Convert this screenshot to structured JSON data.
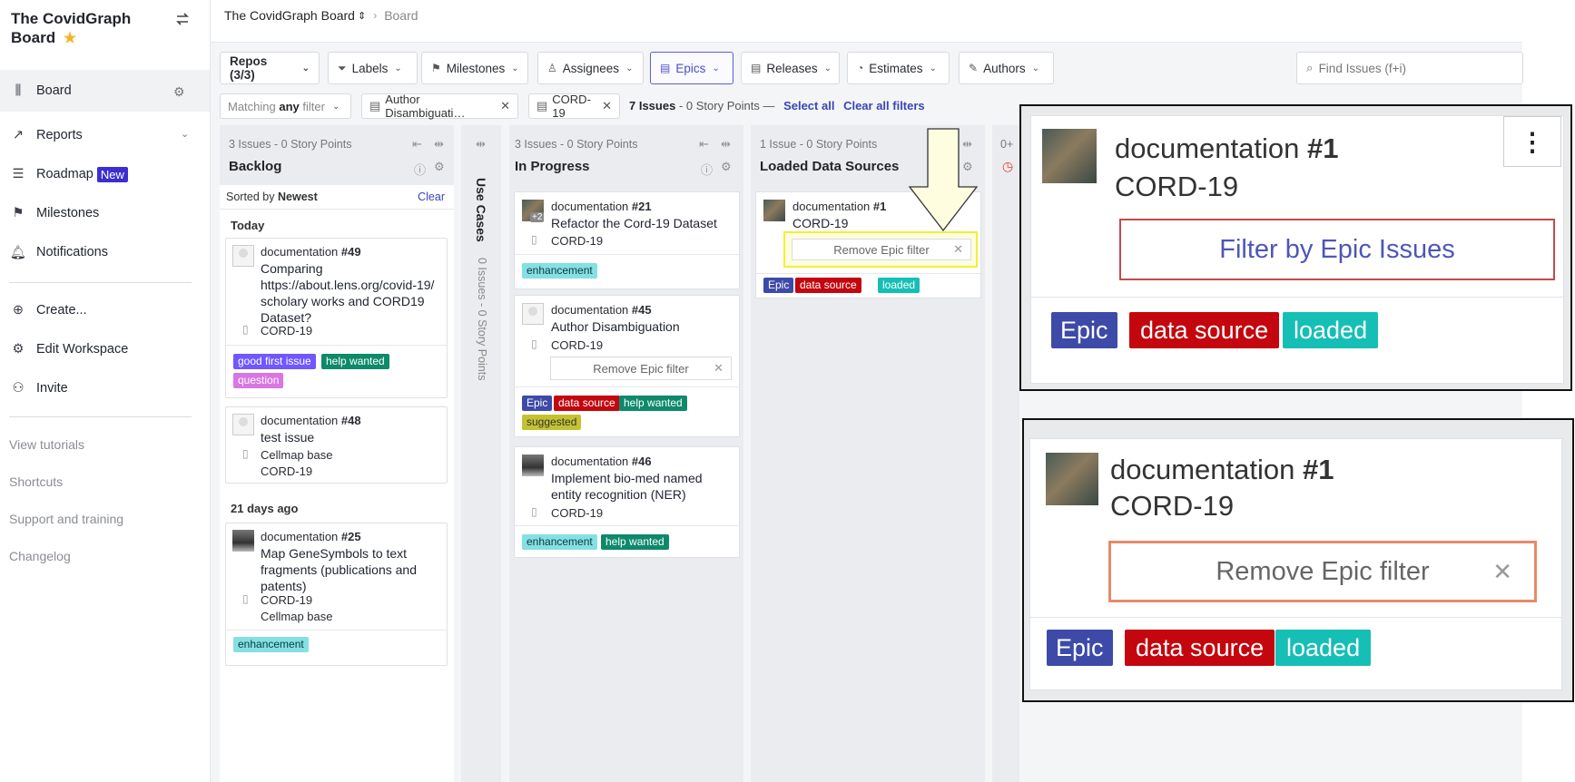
{
  "sidebar": {
    "workspace_title": "The CovidGraph Board",
    "nav": [
      {
        "label": "Board"
      },
      {
        "label": "Reports"
      },
      {
        "label": "Roadmap",
        "badge": "New"
      },
      {
        "label": "Milestones"
      },
      {
        "label": "Notifications"
      },
      {
        "label": "Create..."
      },
      {
        "label": "Edit Workspace"
      },
      {
        "label": "Invite"
      }
    ],
    "links": [
      "View tutorials",
      "Shortcuts",
      "Support and training",
      "Changelog"
    ]
  },
  "breadcrumb": {
    "workspace": "The CovidGraph Board",
    "current": "Board"
  },
  "filters": {
    "buttons": [
      "Repos (3/3)",
      "Labels",
      "Milestones",
      "Assignees",
      "Epics",
      "Releases",
      "Estimates",
      "Authors"
    ],
    "search_placeholder": "Find Issues (f+i)",
    "matching_prefix": "Matching",
    "matching_value": "any",
    "matching_suffix": "filter",
    "chip1": "Author Disambiguati…",
    "chip2": "CORD-19",
    "summary_count": "7 Issues",
    "summary_rest": "- 0 Story Points —",
    "select_all": "Select all",
    "clear_all": "Clear all filters"
  },
  "columns": {
    "backlog": {
      "meta": "3 Issues - 0 Story Points",
      "title": "Backlog",
      "sorted_prefix": "Sorted by",
      "sorted_value": "Newest",
      "clear": "Clear",
      "group_today": "Today",
      "group_older": "21 days ago",
      "cards": [
        {
          "repo": "documentation",
          "num": "#49",
          "title": "Comparing https://about.lens.org/covid-19/ scholary works and CORD19 Dataset?",
          "epic": "CORD-19",
          "labels": [
            "good first issue",
            "help wanted",
            "question"
          ]
        },
        {
          "repo": "documentation",
          "num": "#48",
          "title": "test issue",
          "epic": "Cellmap base",
          "epic2": "CORD-19"
        },
        {
          "repo": "documentation",
          "num": "#25",
          "title": "Map GeneSymbols to text fragments (publications and patents)",
          "epic": "CORD-19",
          "epic2": "Cellmap base",
          "labels": [
            "enhancement"
          ]
        }
      ]
    },
    "usecases": {
      "title": "Use Cases",
      "meta": "0 Issues - 0 Story Points"
    },
    "inprogress": {
      "meta": "3 Issues - 0 Story Points",
      "title": "In Progress",
      "cards": [
        {
          "repo": "documentation",
          "num": "#21",
          "title": "Refactor the Cord-19 Dataset",
          "epic": "CORD-19",
          "avatar_extra": "+2",
          "labels": [
            "enhancement"
          ]
        },
        {
          "repo": "documentation",
          "num": "#45",
          "title": "Author Disambiguation",
          "epic": "CORD-19",
          "remove": "Remove Epic filter",
          "labels": [
            "Epic",
            "data source",
            "help wanted",
            "suggested"
          ]
        },
        {
          "repo": "documentation",
          "num": "#46",
          "title": "Implement bio-med named entity recognition (NER)",
          "epic": "CORD-19",
          "labels": [
            "enhancement",
            "help wanted"
          ]
        }
      ]
    },
    "loaded": {
      "meta": "1 Issue - 0 Story Points",
      "title": "Loaded Data Sources",
      "cards": [
        {
          "repo": "documentation",
          "num": "#1",
          "title": "CORD-19",
          "remove": "Remove Epic filter",
          "labels": [
            "Epic",
            "data source",
            "loaded"
          ]
        }
      ]
    },
    "next_meta": "0+"
  },
  "zoom_top": {
    "repo": "documentation",
    "num": "#1",
    "title": "CORD-19",
    "button": "Filter by Epic Issues",
    "labels": [
      "Epic",
      "data source",
      "loaded"
    ]
  },
  "zoom_bottom": {
    "repo": "documentation",
    "num": "#1",
    "title": "CORD-19",
    "button": "Remove Epic filter",
    "labels": [
      "Epic",
      "data source",
      "loaded"
    ]
  },
  "colors": {
    "accent": "#3b44b8",
    "highlight": "#f3ee3a",
    "epic": "#3d4aa8",
    "data_source": "#c4060e",
    "loaded": "#16bfb5"
  }
}
